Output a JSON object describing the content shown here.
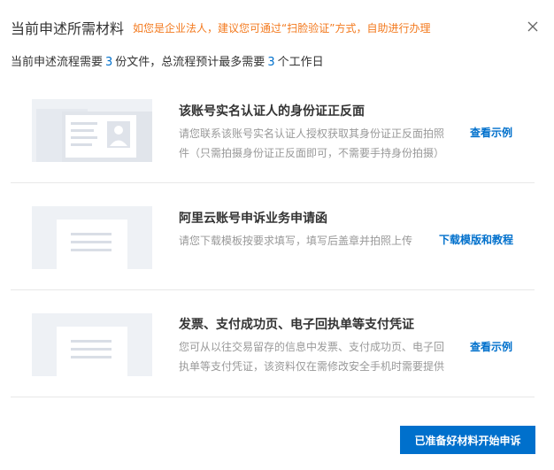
{
  "header": {
    "title": "当前申述所需材料",
    "notice": "如您是企业法人，建议您可通过“扫脸验证”方式，自助进行办理",
    "close_icon": "close-icon"
  },
  "summary": {
    "prefix": "当前申述流程需要",
    "file_count": "3",
    "middle": "份文件，总流程预计最多需要",
    "day_count": "3",
    "suffix": "个工作日"
  },
  "materials": [
    {
      "thumbnail_icon": "id-card-icon",
      "title": "该账号实名认证人的身份证正反面",
      "description": "请您联系该账号实名认证人授权获取其身份证正反面拍照件（只需拍摄身份证正反面即可，不需要手持身份拍摄）",
      "link": "查看示例"
    },
    {
      "thumbnail_icon": "document-icon",
      "title": "阿里云账号申诉业务申请函",
      "description": "请您下载模板按要求填写，填写后盖章并拍照上传",
      "link": "下载模版和教程"
    },
    {
      "thumbnail_icon": "document-icon",
      "title": "发票、支付成功页、电子回执单等支付凭证",
      "description": "您可从以往交易留存的信息中发票、支付成功页、电子回执单等支付凭证，该资料仅在需修改安全手机时需要提供",
      "link": "查看示例"
    }
  ],
  "footer": {
    "submit_label": "已准备好材料开始申诉"
  },
  "colors": {
    "accent": "#0070cc",
    "notice": "#f37a1f",
    "thumbnail_bg": "#eef1f5"
  }
}
